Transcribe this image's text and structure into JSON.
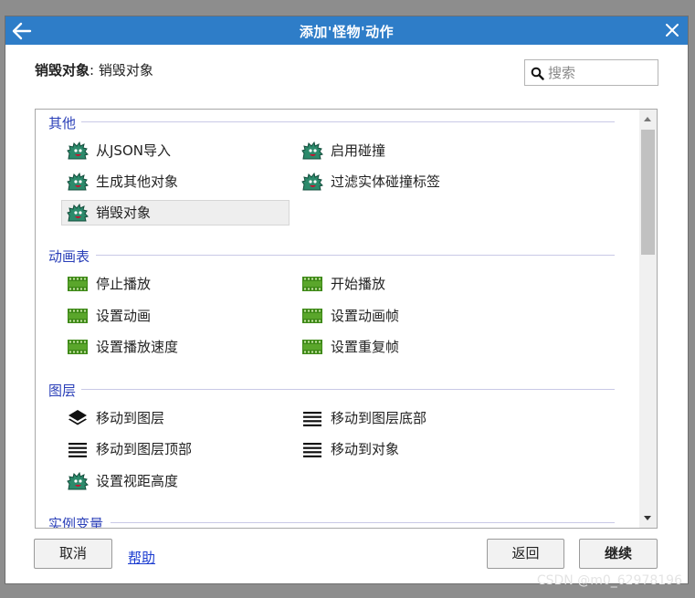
{
  "window": {
    "title": "添加'怪物'动作"
  },
  "header": {
    "label_bold": "销毁对象",
    "separator": ":",
    "label_value": "销毁对象"
  },
  "search": {
    "placeholder": "搜索",
    "value": ""
  },
  "groups": [
    {
      "title": "其他",
      "items": [
        {
          "label": "从JSON导入",
          "icon": "monster-icon"
        },
        {
          "label": "启用碰撞",
          "icon": "monster-icon"
        },
        {
          "label": "生成其他对象",
          "icon": "monster-icon"
        },
        {
          "label": "过滤实体碰撞标签",
          "icon": "monster-icon"
        },
        {
          "label": "销毁对象",
          "icon": "monster-icon",
          "selected": true
        }
      ]
    },
    {
      "title": "动画表",
      "items": [
        {
          "label": "停止播放",
          "icon": "film-strip-icon"
        },
        {
          "label": "开始播放",
          "icon": "film-strip-icon"
        },
        {
          "label": "设置动画",
          "icon": "film-strip-icon"
        },
        {
          "label": "设置动画帧",
          "icon": "film-strip-icon"
        },
        {
          "label": "设置播放速度",
          "icon": "film-strip-icon"
        },
        {
          "label": "设置重复帧",
          "icon": "film-strip-icon"
        }
      ]
    },
    {
      "title": "图层",
      "items": [
        {
          "label": "移动到图层",
          "icon": "layers-icon"
        },
        {
          "label": "移动到图层底部",
          "icon": "lines-icon"
        },
        {
          "label": "移动到图层顶部",
          "icon": "lines-icon"
        },
        {
          "label": "移动到对象",
          "icon": "lines-icon"
        },
        {
          "label": "设置视距高度",
          "icon": "monster-icon"
        }
      ]
    },
    {
      "title": "实例变量",
      "items": []
    }
  ],
  "footer": {
    "cancel": "取消",
    "help": "帮助",
    "back": "返回",
    "continue": "继续"
  },
  "watermark": "CSDN @m0_62978196",
  "colors": {
    "titlebar": "#2e7dc8",
    "group_title": "#2a3fb8",
    "monster": "#2c8a6b",
    "film": "#3f8a18"
  }
}
